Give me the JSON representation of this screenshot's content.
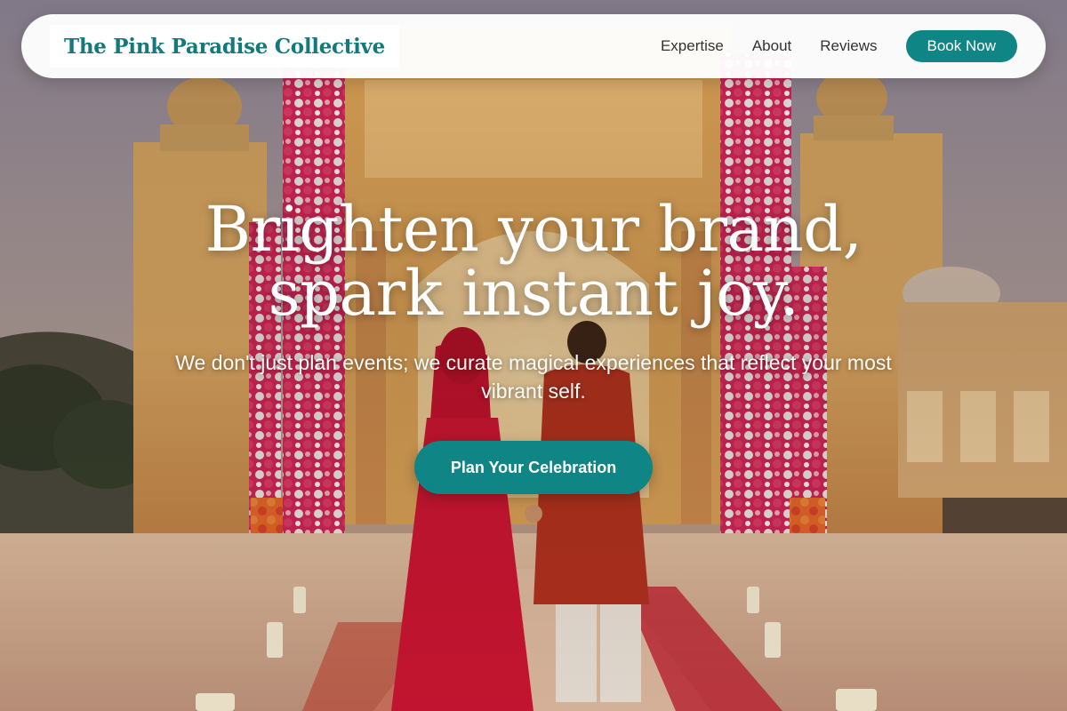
{
  "brand": {
    "name": "The Pink Paradise Collective"
  },
  "nav": {
    "items": [
      {
        "label": "Expertise"
      },
      {
        "label": "About"
      },
      {
        "label": "Reviews"
      }
    ],
    "cta_label": "Book Now"
  },
  "hero": {
    "title_line1": "Brighten your brand,",
    "title_line2": "spark instant joy.",
    "subtitle": "We don't just plan events; we curate magical experiences that reflect your most vibrant self.",
    "cta_label": "Plan Your Celebration",
    "background": "photo of a couple in red wedding attire under a floral mandap at an ornate palace"
  },
  "colors": {
    "accent": "#0f8585",
    "brand_text": "#127a7a",
    "nav_text": "#333333",
    "hero_text": "#ffffff"
  }
}
